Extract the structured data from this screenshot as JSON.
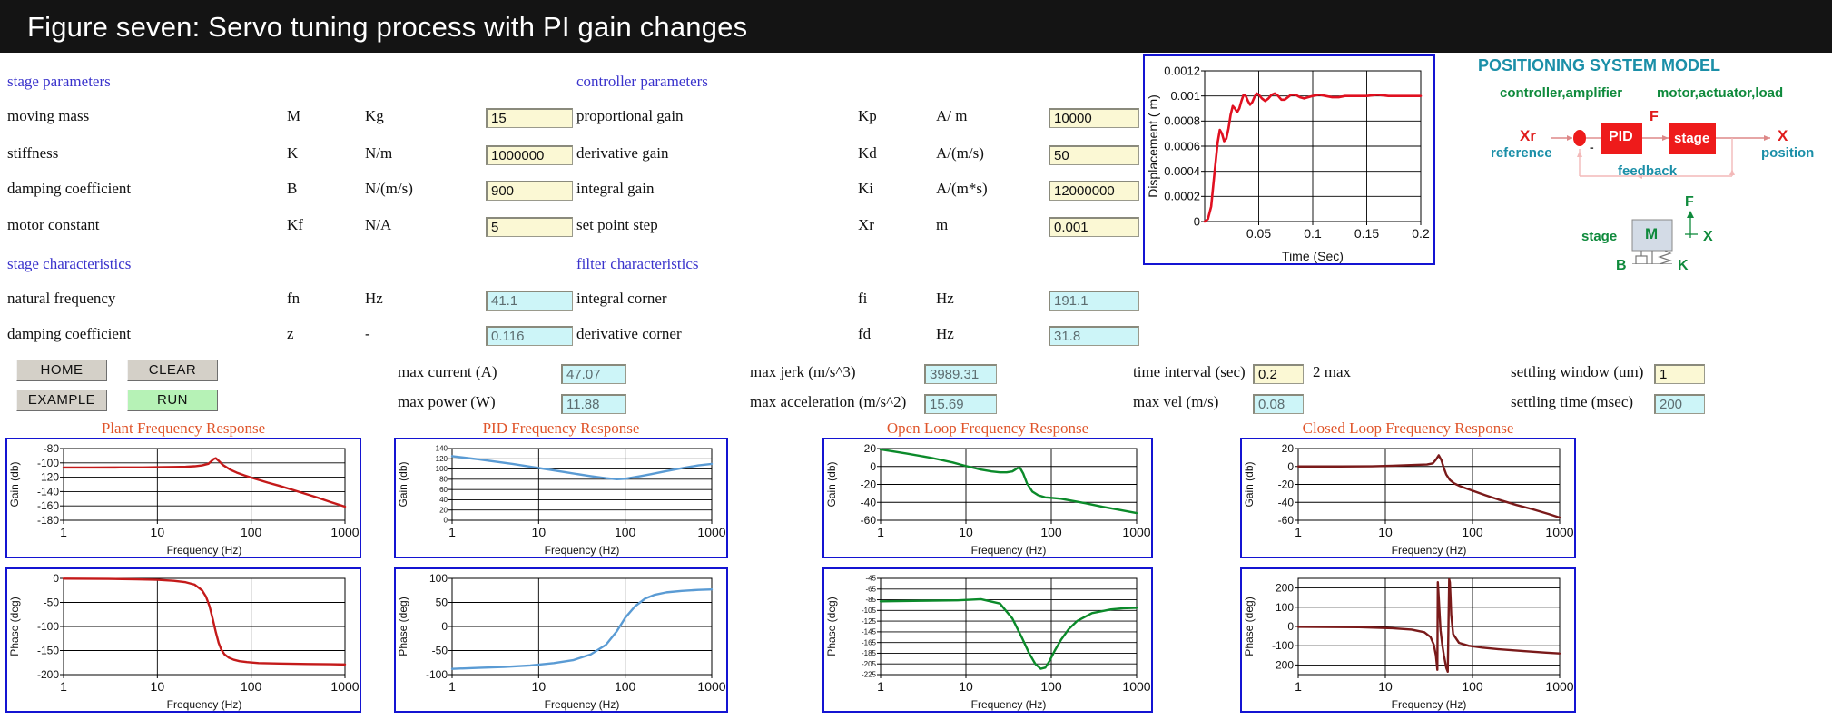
{
  "title": "Figure seven: Servo tuning process with PI gain changes",
  "sections": {
    "stage_parameters": "stage parameters",
    "controller_parameters": "controller parameters",
    "stage_characteristics": "stage characteristics",
    "filter_characteristics": "filter characteristics"
  },
  "stage_parameters": [
    {
      "label": "moving mass",
      "symbol": "M",
      "unit": "Kg",
      "value": "15"
    },
    {
      "label": "stiffness",
      "symbol": "K",
      "unit": "N/m",
      "value": "1000000"
    },
    {
      "label": "damping coefficient",
      "symbol": "B",
      "unit": "N/(m/s)",
      "value": "900"
    },
    {
      "label": "motor constant",
      "symbol": "Kf",
      "unit": "N/A",
      "value": "5"
    }
  ],
  "controller_parameters": [
    {
      "label": "proportional gain",
      "symbol": "Kp",
      "unit": "A/ m",
      "value": "10000"
    },
    {
      "label": "derivative gain",
      "symbol": "Kd",
      "unit": "A/(m/s)",
      "value": "50"
    },
    {
      "label": "integral gain",
      "symbol": "Ki",
      "unit": "A/(m*s)",
      "value": "12000000"
    },
    {
      "label": "set point step",
      "symbol": "Xr",
      "unit": "m",
      "value": "0.001"
    }
  ],
  "stage_characteristics": [
    {
      "label": "natural frequency",
      "symbol": "fn",
      "unit": "Hz",
      "value": "41.1"
    },
    {
      "label": "damping coefficient",
      "symbol": "z",
      "unit": "-",
      "value": "0.116"
    }
  ],
  "filter_characteristics": [
    {
      "label": "integral corner",
      "symbol": "fi",
      "unit": "Hz",
      "value": "191.1"
    },
    {
      "label": "derivative corner",
      "symbol": "fd",
      "unit": "Hz",
      "value": "31.8"
    }
  ],
  "buttons": {
    "home": "HOME",
    "clear": "CLEAR",
    "example": "EXAMPLE",
    "run": "RUN"
  },
  "metrics": [
    {
      "label": "max current (A)",
      "value": "47.07",
      "readonly": true
    },
    {
      "label": "max power (W)",
      "value": "11.88",
      "readonly": true
    },
    {
      "label": "max jerk (m/s^3)",
      "value": "3989.31",
      "readonly": true
    },
    {
      "label": "max acceleration (m/s^2)",
      "value": "15.69",
      "readonly": true
    },
    {
      "label": "time interval (sec)",
      "value": "0.2",
      "readonly": false,
      "suffix": "2 max"
    },
    {
      "label": "max vel (m/s)",
      "value": "0.08",
      "readonly": true
    },
    {
      "label": "settling window (um)",
      "value": "1",
      "readonly": false
    },
    {
      "label": "settling time (msec)",
      "value": "200",
      "readonly": true
    }
  ],
  "diagram": {
    "title": "POSITIONING SYSTEM MODEL",
    "left_group": "controller,amplifier",
    "right_group": "motor,actuator,load",
    "block_pid": "PID",
    "block_stage": "stage",
    "input_symbol": "Xr",
    "input_label": "reference",
    "output_symbol": "X",
    "output_label": "position",
    "force_symbol": "F",
    "feedback": "feedback",
    "minus": "-",
    "stage_label": "stage",
    "mass_symbol": "M",
    "mass_force": "F",
    "mass_disp": "X",
    "damper_symbol": "B",
    "spring_symbol": "K"
  },
  "chart_data": [
    {
      "id": "step_response",
      "type": "line",
      "title": "Step Response",
      "xlabel": "Time (Sec)",
      "ylabel": "Displacement ( m)",
      "xlim": [
        0,
        0.2
      ],
      "ylim": [
        0,
        0.0012
      ],
      "xticks": [
        "0.05",
        "0.1",
        "0.15",
        "0.2"
      ],
      "yticks": [
        "0",
        "0.0002",
        "0.0004",
        "0.0006",
        "0.0008",
        "0.001",
        "0.0012"
      ],
      "grid": true,
      "color": "#e01020",
      "series": [
        {
          "name": "displacement",
          "x": [
            0.0,
            0.003,
            0.006,
            0.009,
            0.012,
            0.014,
            0.016,
            0.018,
            0.02,
            0.022,
            0.024,
            0.026,
            0.028,
            0.03,
            0.032,
            0.034,
            0.036,
            0.038,
            0.04,
            0.042,
            0.044,
            0.046,
            0.048,
            0.05,
            0.053,
            0.056,
            0.059,
            0.062,
            0.065,
            0.068,
            0.071,
            0.074,
            0.077,
            0.08,
            0.084,
            0.088,
            0.092,
            0.096,
            0.1,
            0.106,
            0.112,
            0.118,
            0.124,
            0.13,
            0.14,
            0.15,
            0.16,
            0.17,
            0.18,
            0.19,
            0.2
          ],
          "y": [
            0.0,
            2e-05,
            0.00012,
            0.00038,
            0.00063,
            0.00073,
            0.0007,
            0.00064,
            0.00066,
            0.00074,
            0.00085,
            0.00092,
            0.0009,
            0.00087,
            0.0009,
            0.00096,
            0.00101,
            0.001,
            0.00096,
            0.00093,
            0.00095,
            0.00099,
            0.00102,
            0.00101,
            0.00098,
            0.00096,
            0.00098,
            0.00101,
            0.00102,
            0.001,
            0.00097,
            0.00097,
            0.00099,
            0.00101,
            0.00101,
            0.00099,
            0.00098,
            0.00099,
            0.001,
            0.00101,
            0.001,
            0.00099,
            0.00099,
            0.001,
            0.001,
            0.001,
            0.00101,
            0.001,
            0.001,
            0.001,
            0.001
          ]
        }
      ]
    },
    {
      "id": "plant_gain",
      "type": "line",
      "title": "Plant Frequency Response",
      "xlabel": "Frequency (Hz)",
      "ylabel": "Gain (db)",
      "xscale": "log",
      "xlim": [
        1,
        1000
      ],
      "ylim": [
        -180,
        -80
      ],
      "xticks": [
        "1",
        "10",
        "100",
        "1000"
      ],
      "yticks": [
        "-80",
        "-100",
        "-120",
        "-140",
        "-160",
        "-180"
      ],
      "grid": true,
      "color": "#c41a1a",
      "series": [
        {
          "name": "gain",
          "x": [
            1,
            2,
            4,
            7,
            10,
            15,
            20,
            25,
            30,
            35,
            40,
            42,
            45,
            50,
            60,
            70,
            85,
            100,
            150,
            200,
            300,
            500,
            700,
            1000
          ],
          "y": [
            -106.5,
            -106.5,
            -106.4,
            -106.3,
            -106.1,
            -105.8,
            -105.4,
            -104.7,
            -103.5,
            -101.3,
            -94.5,
            -93.5,
            -97.0,
            -103.0,
            -109.5,
            -113.5,
            -117.5,
            -120.5,
            -127.5,
            -132.0,
            -139.0,
            -148.0,
            -154.5,
            -161.0
          ]
        }
      ]
    },
    {
      "id": "plant_phase",
      "type": "line",
      "title": "",
      "xlabel": "Frequency (Hz)",
      "ylabel": "Phase (deg)",
      "xscale": "log",
      "xlim": [
        1,
        1000
      ],
      "ylim": [
        -200,
        0
      ],
      "xticks": [
        "1",
        "10",
        "100",
        "1000"
      ],
      "yticks": [
        "0",
        "-50",
        "-100",
        "-150",
        "-200"
      ],
      "grid": true,
      "color": "#c41a1a",
      "series": [
        {
          "name": "phase",
          "x": [
            1,
            3,
            6,
            10,
            15,
            20,
            25,
            30,
            33,
            36,
            39,
            42,
            45,
            48,
            52,
            58,
            65,
            75,
            90,
            120,
            200,
            400,
            700,
            1000
          ],
          "y": [
            -0.5,
            -1,
            -2,
            -3,
            -5,
            -8,
            -13,
            -25,
            -38,
            -58,
            -85,
            -112,
            -134,
            -148,
            -158,
            -165,
            -169,
            -172,
            -174,
            -176,
            -177,
            -178,
            -178.5,
            -179
          ]
        }
      ]
    },
    {
      "id": "pid_gain",
      "type": "line",
      "title": "PID Frequency Response",
      "xlabel": "Frequency (Hz)",
      "ylabel": "Gain (db)",
      "xscale": "log",
      "xlim": [
        1,
        1000
      ],
      "ylim": [
        0,
        140
      ],
      "xticks": [
        "1",
        "10",
        "100",
        "1000"
      ],
      "yticks": [
        "0",
        "20",
        "40",
        "60",
        "80",
        "100",
        "120",
        "140"
      ],
      "grid": true,
      "color": "#5a9bd4",
      "series": [
        {
          "name": "gain",
          "x": [
            1,
            2,
            5,
            10,
            20,
            40,
            60,
            80,
            100,
            150,
            200,
            300,
            500,
            700,
            1000
          ],
          "y": [
            125,
            119,
            110,
            102,
            94,
            86,
            82,
            80,
            81,
            86,
            90,
            96,
            103,
            107,
            110
          ]
        }
      ]
    },
    {
      "id": "pid_phase",
      "type": "line",
      "title": "",
      "xlabel": "Frequency (Hz)",
      "ylabel": "Phase (deg)",
      "xscale": "log",
      "xlim": [
        1,
        1000
      ],
      "ylim": [
        -100,
        100
      ],
      "xticks": [
        "1",
        "10",
        "100",
        "1000"
      ],
      "yticks": [
        "100",
        "50",
        "0",
        "-50",
        "-100"
      ],
      "grid": true,
      "color": "#5a9bd4",
      "series": [
        {
          "name": "phase",
          "x": [
            1,
            2,
            4,
            8,
            15,
            25,
            40,
            60,
            80,
            100,
            130,
            170,
            220,
            300,
            450,
            700,
            1000
          ],
          "y": [
            -88,
            -86,
            -84,
            -81,
            -76,
            -70,
            -58,
            -38,
            -10,
            18,
            42,
            58,
            66,
            71,
            74,
            76,
            77
          ]
        }
      ]
    },
    {
      "id": "open_loop_gain",
      "type": "line",
      "title": "Open Loop Frequency Response",
      "xlabel": "Frequency (Hz)",
      "ylabel": "Gain (db)",
      "xscale": "log",
      "xlim": [
        1,
        1000
      ],
      "ylim": [
        -60,
        20
      ],
      "xticks": [
        "1",
        "10",
        "100",
        "1000"
      ],
      "yticks": [
        "20",
        "0",
        "-20",
        "-40",
        "-60"
      ],
      "grid": true,
      "color": "#0b8a2a",
      "series": [
        {
          "name": "gain",
          "x": [
            1,
            2,
            4,
            7,
            10,
            15,
            20,
            25,
            30,
            35,
            40,
            43,
            47,
            52,
            60,
            70,
            85,
            100,
            130,
            170,
            250,
            400,
            600,
            1000
          ],
          "y": [
            19,
            14.5,
            9.5,
            4.5,
            0.5,
            -3.5,
            -5.5,
            -6.5,
            -6.5,
            -5.5,
            -2.0,
            -1.5,
            -8,
            -19,
            -28,
            -32,
            -34.5,
            -35,
            -36,
            -38,
            -41,
            -45,
            -48,
            -52
          ]
        }
      ]
    },
    {
      "id": "open_loop_phase",
      "type": "line",
      "title": "",
      "xlabel": "Frequency (Hz)",
      "ylabel": "Phase (deg)",
      "xscale": "log",
      "xlim": [
        1,
        1000
      ],
      "ylim": [
        -225,
        -45
      ],
      "xticks": [
        "1",
        "10",
        "100",
        "1000"
      ],
      "yticks": [
        "-45",
        "-65",
        "-85",
        "-105",
        "-125",
        "-145",
        "-165",
        "-185",
        "-205",
        "-225"
      ],
      "grid": true,
      "color": "#0b8a2a",
      "series": [
        {
          "name": "phase",
          "x": [
            1,
            3,
            8,
            15,
            25,
            35,
            45,
            55,
            65,
            75,
            85,
            95,
            110,
            130,
            160,
            200,
            300,
            500,
            700,
            1000
          ],
          "y": [
            -88,
            -87,
            -86,
            -84,
            -92,
            -120,
            -155,
            -185,
            -205,
            -214,
            -212,
            -200,
            -180,
            -160,
            -140,
            -125,
            -110,
            -103,
            -101,
            -100
          ]
        }
      ]
    },
    {
      "id": "closed_loop_gain",
      "type": "line",
      "title": "Closed Loop Frequency Response",
      "xlabel": "Frequency (Hz)",
      "ylabel": "Gain (db)",
      "xscale": "log",
      "xlim": [
        1,
        1000
      ],
      "ylim": [
        -60,
        20
      ],
      "xticks": [
        "1",
        "10",
        "100",
        "1000"
      ],
      "yticks": [
        "20",
        "0",
        "-20",
        "-40",
        "-60"
      ],
      "grid": true,
      "color": "#7a1a1a",
      "series": [
        {
          "name": "gain",
          "x": [
            1,
            3,
            7,
            12,
            18,
            25,
            30,
            35,
            38,
            41,
            44,
            47,
            50,
            55,
            62,
            70,
            85,
            100,
            140,
            200,
            320,
            500,
            750,
            1000
          ],
          "y": [
            0,
            0,
            0.2,
            0.8,
            1.5,
            2.0,
            2.2,
            3.5,
            7.5,
            12.5,
            7.0,
            -2.0,
            -9.0,
            -15.0,
            -19.0,
            -21.5,
            -24.5,
            -27.0,
            -32.0,
            -37.0,
            -43.0,
            -48.0,
            -53.0,
            -57.0
          ]
        }
      ]
    },
    {
      "id": "closed_loop_phase",
      "type": "line",
      "title": "",
      "xlabel": "Frequency (Hz)",
      "ylabel": "Phase (deg)",
      "xscale": "log",
      "xlim": [
        1,
        1000
      ],
      "ylim": [
        -250,
        250
      ],
      "xticks": [
        "1",
        "10",
        "100",
        "1000"
      ],
      "yticks": [
        "200",
        "100",
        "0",
        "-100",
        "-200"
      ],
      "grid": true,
      "color": "#7a1a1a",
      "series": [
        {
          "name": "phase",
          "x": [
            1,
            5,
            12,
            20,
            28,
            33,
            36,
            38,
            39.5,
            40,
            41,
            42,
            43,
            45,
            47,
            50,
            52,
            54,
            55,
            56,
            57,
            60,
            70,
            90,
            130,
            200,
            400,
            700,
            1000
          ],
          "y": [
            -2,
            -4,
            -9,
            -16,
            -30,
            -55,
            -95,
            -150,
            -225,
            230,
            150,
            60,
            -20,
            -95,
            -150,
            -215,
            -235,
            245,
            230,
            150,
            60,
            -40,
            -85,
            -100,
            -110,
            -118,
            -128,
            -136,
            -140
          ]
        }
      ]
    }
  ],
  "plot_titles": {
    "plant": "Plant Frequency Response",
    "pid": "PID Frequency Response",
    "open_loop": "Open Loop Frequency Response",
    "closed_loop": "Closed Loop Frequency Response"
  }
}
